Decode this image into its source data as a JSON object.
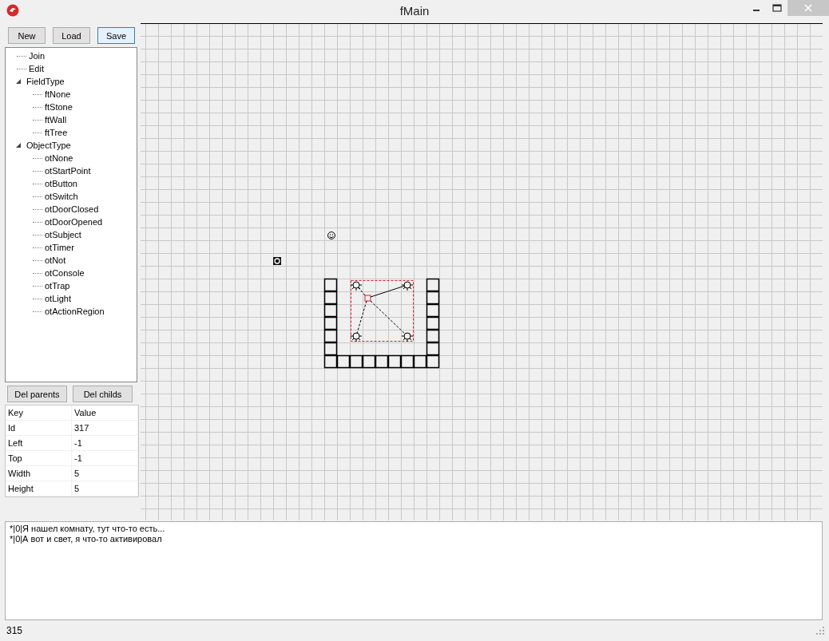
{
  "window": {
    "title": "fMain"
  },
  "toolbar": [
    {
      "label": "New",
      "focused": false
    },
    {
      "label": "Load",
      "focused": false
    },
    {
      "label": "Save",
      "focused": true
    }
  ],
  "tree": [
    {
      "label": "Join"
    },
    {
      "label": "Edit"
    },
    {
      "label": "FieldType",
      "expanded": true,
      "children": [
        {
          "label": "ftNone"
        },
        {
          "label": "ftStone"
        },
        {
          "label": "ftWall"
        },
        {
          "label": "ftTree"
        }
      ]
    },
    {
      "label": "ObjectType",
      "expanded": true,
      "children": [
        {
          "label": "otNone"
        },
        {
          "label": "otStartPoint"
        },
        {
          "label": "otButton"
        },
        {
          "label": "otSwitch"
        },
        {
          "label": "otDoorClosed"
        },
        {
          "label": "otDoorOpened"
        },
        {
          "label": "otSubject"
        },
        {
          "label": "otTimer"
        },
        {
          "label": "otNot"
        },
        {
          "label": "otConsole"
        },
        {
          "label": "otTrap"
        },
        {
          "label": "otLight"
        },
        {
          "label": "otActionRegion"
        }
      ]
    }
  ],
  "tree_buttons": [
    {
      "label": "Del parents"
    },
    {
      "label": "Del childs"
    }
  ],
  "properties": {
    "columns": [
      "Key",
      "Value"
    ],
    "rows": [
      [
        "Id",
        "317"
      ],
      [
        "Left",
        "-1"
      ],
      [
        "Top",
        "-1"
      ],
      [
        "Width",
        "5"
      ],
      [
        "Height",
        "5"
      ]
    ]
  },
  "log": [
    "*|0|Я нашел комнату, тут что-то есть...",
    "*|0|А вот и свет, я что-то активировал"
  ],
  "status_bar": "315"
}
